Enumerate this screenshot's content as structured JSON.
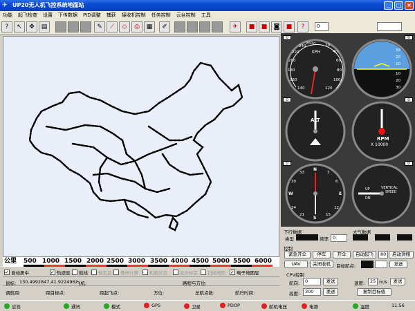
{
  "window": {
    "title": "UP20无人机飞控系统地面站",
    "controls": {
      "min": "_",
      "max": "□",
      "close": "×"
    }
  },
  "menu": [
    "功能",
    "起飞检查",
    "设置",
    "下传数据",
    "PID调整",
    "捕获",
    "接收机控制",
    "任务控制",
    "云台控制",
    "工具"
  ],
  "toolbar": {
    "field_value": "0"
  },
  "scale": {
    "label": "公里",
    "ticks": [
      "500",
      "1000",
      "1500",
      "2000",
      "2500",
      "3000",
      "3500",
      "4000",
      "4500",
      "5000",
      "5500",
      "6000"
    ]
  },
  "options": {
    "auto_center": "自动居中",
    "track": "轨迹显",
    "route": "航线",
    "mark_pos": "标定显",
    "hover_calc": "悬停计算",
    "aircraft_state": "机载状态",
    "display_mark": "显示标定",
    "scan_map": "扫描地图",
    "electronic_map": "电子地图层"
  },
  "readouts": {
    "cursor_label": "鼠标:",
    "cursor_value": "130.4992847,41.9224962",
    "aircraft_label": "飞机:",
    "heading_label": "路程与方位:",
    "dist_label": "调航距:",
    "target_dist_label": "距目标点:",
    "takeoff_dist_label": "距起飞点:",
    "bearing_label": "方位:",
    "waypoint_label": "总航点数:",
    "time_label": "航行时间:"
  },
  "gauges": {
    "asi": {
      "unit": "KPH",
      "scale": [
        "0",
        "20",
        "40",
        "60",
        "80",
        "100",
        "120",
        "140",
        "160",
        "180",
        "200",
        "220",
        "240",
        "260"
      ],
      "readout": "0"
    },
    "horizon": {
      "marks": [
        "30",
        "20",
        "10",
        "10",
        "20",
        "30"
      ],
      "readout": "0"
    },
    "alt": {
      "name": "ALT",
      "readout": "0"
    },
    "rpm": {
      "name": "RPM",
      "sub": "X 10000",
      "readout": "0"
    },
    "heading": {
      "letters": [
        "N",
        "E",
        "S",
        "W"
      ],
      "nums": [
        "3",
        "6",
        "12",
        "15",
        "21",
        "24",
        "30",
        "33"
      ],
      "readout": "0"
    },
    "vsi": {
      "line1": "VERTICAL",
      "line2": "SPEED",
      "up": "UP",
      "dn": "DN",
      "readout": "0"
    }
  },
  "downlink": {
    "title": "下行数据",
    "type_label": "类型",
    "freq_label": "频率",
    "freq_value": "0"
  },
  "atmos": {
    "title": "大气数据"
  },
  "control": {
    "title": "控制",
    "btn_emergency": "紧急开伞",
    "btn_stop": "停车",
    "btn_open": "开伞",
    "btn_auto_takeoff": "自动起飞",
    "field_80": "80",
    "btn_auto_glide": "启动滑翔",
    "btn_uav": "UAV",
    "btn_close_rx": "关闭收机",
    "target_label": "目标航点:",
    "btn_send": "发送"
  },
  "cpv": {
    "title": "CPV控制",
    "heading_label": "航向:",
    "heading_val": "0",
    "send": "发送",
    "speed_label": "速度:",
    "speed_val": "25",
    "speed_unit": "m/s",
    "alt_label": "高度:",
    "alt_val": "300",
    "btn_reset": "复制目标值"
  },
  "status": [
    {
      "label": "应答",
      "color": "g"
    },
    {
      "label": "通讯",
      "color": "g"
    },
    {
      "label": "模式",
      "color": "g"
    },
    {
      "label": "GPS",
      "color": "r"
    },
    {
      "label": "卫星",
      "color": "r"
    },
    {
      "label": "PDOP",
      "color": "r"
    },
    {
      "label": "航机电压",
      "color": "r"
    },
    {
      "label": "电源",
      "color": "r"
    },
    {
      "label": "温度",
      "color": "g"
    }
  ],
  "clock": "11:56"
}
